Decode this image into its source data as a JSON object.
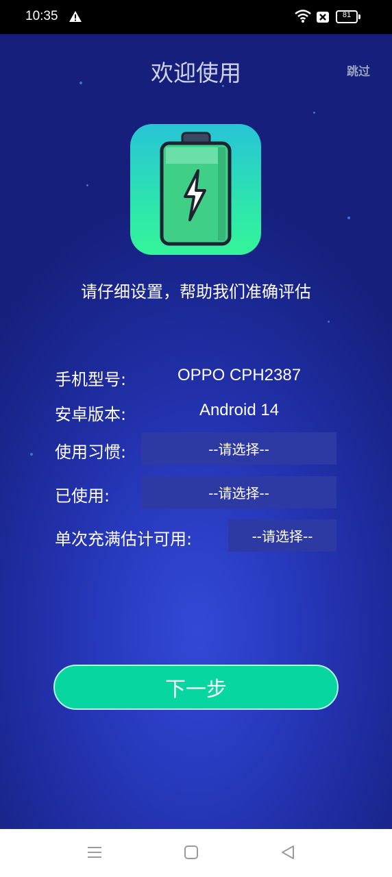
{
  "status_bar": {
    "time": "10:35",
    "battery_level": "81",
    "icons": [
      "warning-icon",
      "wifi-icon",
      "no-sim-icon",
      "battery-icon"
    ]
  },
  "header": {
    "title": "欢迎使用",
    "skip_label": "跳过"
  },
  "subtitle": "请仔细设置，帮助我们准确评估",
  "form": {
    "model_label": "手机型号:",
    "model_value": "OPPO CPH2387",
    "android_label": "安卓版本:",
    "android_value": "Android 14",
    "habit_label": "使用习惯:",
    "habit_value": "--请选择--",
    "used_label": "已使用:",
    "used_value": "--请选择--",
    "full_charge_label": "单次充满估计可用:",
    "full_charge_value": "--请选择--"
  },
  "next_button": "下一步",
  "colors": {
    "accent": "#08d6a0",
    "background": "#2739bd",
    "select_bg": "#2e3aa4"
  },
  "nav_bar": {
    "icons": [
      "menu-icon",
      "home-icon",
      "back-icon"
    ]
  }
}
